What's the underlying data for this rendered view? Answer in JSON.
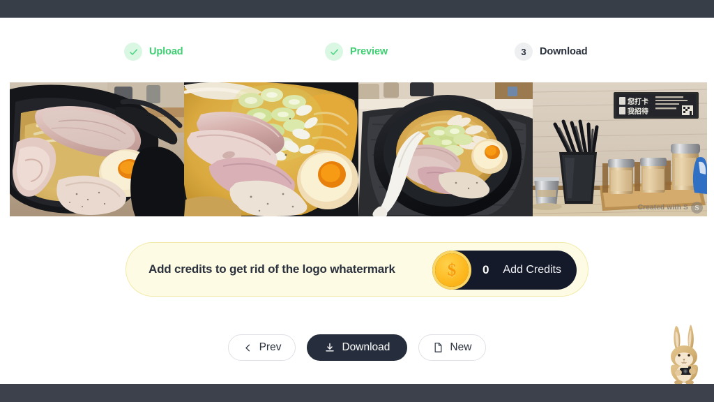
{
  "window": {
    "topbar_color": "#383E47",
    "bottombar_color": "#3C414B"
  },
  "stepper": {
    "steps": [
      {
        "index": "1",
        "label": "Upload",
        "state": "done",
        "icon": "check-icon"
      },
      {
        "index": "2",
        "label": "Preview",
        "state": "done",
        "icon": "check-icon"
      },
      {
        "index": "3",
        "label": "Download",
        "state": "pending",
        "icon": "number"
      }
    ],
    "done_color": "#3ECF72",
    "done_badge_color": "#D9F7E3",
    "pending_color": "#2A303C",
    "pending_badge_color": "#EEEFF1"
  },
  "gallery": {
    "images": [
      {
        "alt": "Close-up of ramen bowl with sliced chashu pork held by chopsticks and a soft-boiled egg",
        "watermark": ""
      },
      {
        "alt": "Overhead close-up of miso ramen with chopped green onion, chashu slices and halved ajitama egg",
        "watermark": ""
      },
      {
        "alt": "Full black bowl of miso ramen on a black tray with a white spoon",
        "watermark": ""
      },
      {
        "alt": "Restaurant condiment station with black chopstick holder, metal seasoning shakers on a wooden tray and a wall sign",
        "watermark": "Created with S"
      }
    ],
    "watermark_badge": "S"
  },
  "credits_banner": {
    "message": "Add credits to get rid of the logo whatermark",
    "coin_icon": "dollar-coin-icon",
    "coin_symbol": "$",
    "balance": "0",
    "cta_label": "Add Credits",
    "background": "#FDFBE4",
    "border": "#F2E9A6",
    "pill_background": "#141A29"
  },
  "actions": {
    "prev": {
      "label": "Prev",
      "icon": "chevron-left-icon"
    },
    "download": {
      "label": "Download",
      "icon": "download-icon"
    },
    "new": {
      "label": "New",
      "icon": "document-icon"
    }
  },
  "mascot": {
    "name": "rabbit-mascot",
    "description": "Tan rabbit mascot holding a dark camera"
  }
}
